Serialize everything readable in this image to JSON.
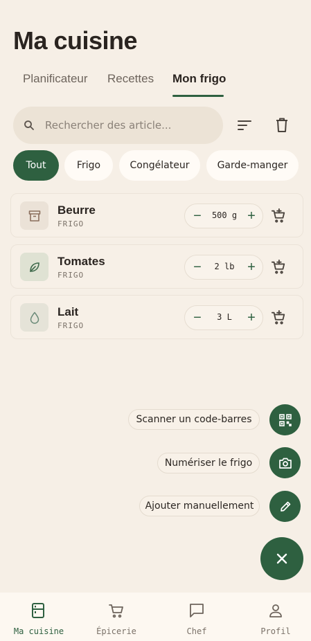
{
  "header": {
    "title": "Ma cuisine"
  },
  "tabs": [
    {
      "label": "Planificateur"
    },
    {
      "label": "Recettes"
    },
    {
      "label": "Mon frigo",
      "active": true
    }
  ],
  "search": {
    "placeholder": "Rechercher des article..."
  },
  "filters": [
    {
      "label": "Tout",
      "active": true
    },
    {
      "label": "Frigo"
    },
    {
      "label": "Congélateur"
    },
    {
      "label": "Garde-manger"
    }
  ],
  "items": [
    {
      "name": "Beurre",
      "location": "FRIGO",
      "quantity": "500 g",
      "icon": "archive-box-icon"
    },
    {
      "name": "Tomates",
      "location": "FRIGO",
      "quantity": "2 lb",
      "icon": "leaf-icon"
    },
    {
      "name": "Lait",
      "location": "FRIGO",
      "quantity": "3 L",
      "icon": "drop-icon"
    }
  ],
  "fab_actions": [
    {
      "label": "Scanner un code-barres",
      "icon": "qr-scan-icon"
    },
    {
      "label": "Numériser le frigo",
      "icon": "camera-icon"
    },
    {
      "label": "Ajouter manuellement",
      "icon": "pencil-icon"
    }
  ],
  "bottom_nav": [
    {
      "label": "Ma cuisine",
      "icon": "fridge-icon",
      "active": true
    },
    {
      "label": "Épicerie",
      "icon": "cart-icon"
    },
    {
      "label": "Chef",
      "icon": "chat-icon"
    },
    {
      "label": "Profil",
      "icon": "person-icon"
    }
  ],
  "colors": {
    "accent": "#2e6040",
    "background": "#f6efe6"
  }
}
